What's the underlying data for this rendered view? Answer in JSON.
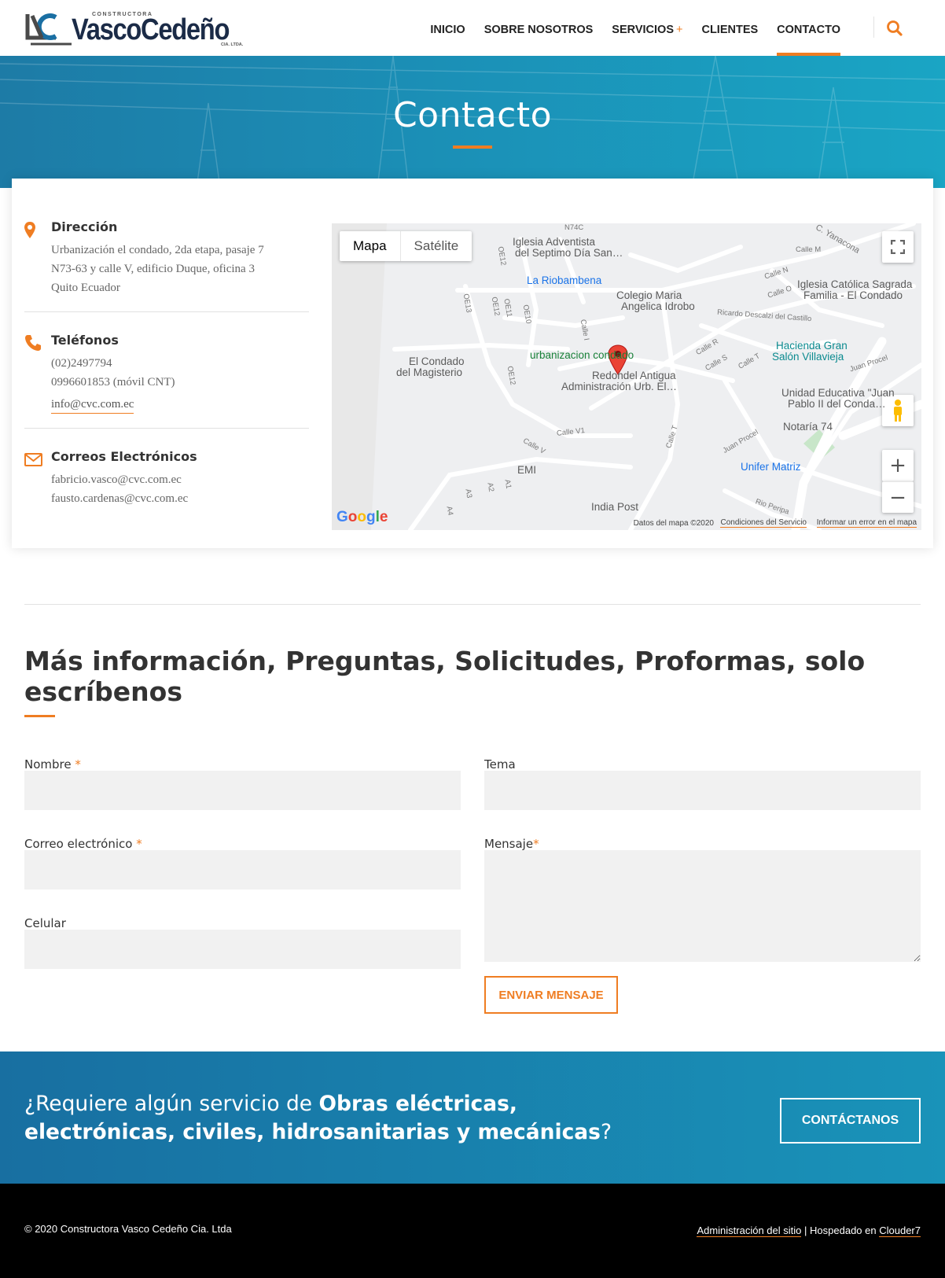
{
  "header": {
    "logo_small": "CONSTRUCTORA",
    "logo_name": "VascoCedeño",
    "logo_sub": "CIA. LTDA.",
    "nav": [
      {
        "label": "INICIO"
      },
      {
        "label": "SOBRE NOSOTROS"
      },
      {
        "label": "SERVICIOS",
        "suffix": "+"
      },
      {
        "label": "CLIENTES"
      },
      {
        "label": "CONTACTO",
        "active": true
      }
    ],
    "search_icon": "search-icon"
  },
  "hero": {
    "title": "Contacto"
  },
  "contact": {
    "address": {
      "icon": "map-pin-icon",
      "title": "Dirección",
      "lines": [
        "Urbanización el condado, 2da etapa, pasaje 7",
        "N73-63 y calle V, edificio Duque, oficina 3",
        "Quito Ecuador"
      ]
    },
    "phones": {
      "icon": "phone-icon",
      "title": "Teléfonos",
      "lines": [
        "(02)2497794",
        "0996601853 (móvil CNT)"
      ],
      "email_link": "info@cvc.com.ec"
    },
    "emails": {
      "icon": "envelope-icon",
      "title": "Correos Electrónicos",
      "lines": [
        "fabricio.vasco@cvc.com.ec",
        "fausto.cardenas@cvc.com.ec"
      ]
    }
  },
  "map": {
    "tabs": [
      "Mapa",
      "Satélite"
    ],
    "labels": {
      "iglesia_adventista": "Iglesia Adventista",
      "iglesia_adventista_2": "del Septimo Día San…",
      "la_riobambena": "La Riobambena",
      "colegio": "Colegio Maria",
      "colegio_2": "Angelica Idrobo",
      "iglesia_catolica": "Iglesia Católica Sagrada",
      "iglesia_catolica_2": "Familia - El Condado",
      "condado_magisterio": "El Condado",
      "condado_magisterio_2": "del Magisterio",
      "urbanizacion": "urbanizacion condado",
      "redondel": "Redondel Antigua",
      "redondel_2": "Administración Urb. El…",
      "hacienda": "Hacienda Gran",
      "hacienda_2": "Salón Villavieja",
      "unidad": "Unidad Educativa \"Juan",
      "unidad_2": "Pablo II del Conda…",
      "notaria": "Notaría 74",
      "unifer": "Unifer Matriz",
      "emi": "EMI",
      "india_post": "India Post",
      "ricardo": "Ricardo Descalzi del Castillo",
      "yanacona": "C. Yanacona",
      "juan_procel": "Juan Procel",
      "rio_peripa": "Rio Peripa",
      "n74c": "N74C",
      "calle_m": "Calle M",
      "calle_n": "Calle N",
      "calle_o": "Calle O",
      "calle_r": "Calle R",
      "calle_s": "Calle S",
      "calle_t": "Calle T",
      "calle_v": "Calle V",
      "calle_v1": "Calle V1",
      "calle_i": "Calle I",
      "oe13": "OE13",
      "oe12": "OE12",
      "oe11": "OE11",
      "oe10": "OE10",
      "a1": "A1",
      "a2": "A2",
      "a3": "A3",
      "a4": "A4"
    },
    "google": "Google",
    "footer_data": "Datos del mapa ©2020",
    "footer_terms": "Condiciones del Servicio",
    "footer_report": "Informar un error en el mapa",
    "fullscreen_icon": "fullscreen-icon",
    "pegman_icon": "pegman-icon",
    "zoom_in": "+",
    "zoom_out": "−"
  },
  "form": {
    "title": "Más información, Preguntas, Solicitudes, Proformas, solo escríbenos",
    "nombre_label": "Nombre",
    "correo_label": "Correo electrónico",
    "celular_label": "Celular",
    "tema_label": "Tema",
    "mensaje_label": "Mensaje",
    "required_mark": "*",
    "nombre_value": "",
    "correo_value": "",
    "celular_value": "",
    "tema_value": "",
    "mensaje_value": "",
    "submit_label": "ENVIAR MENSAJE"
  },
  "cta": {
    "prefix": "¿Requiere algún servicio de ",
    "bold": "Obras eléctricas, electrónicas, civiles, hidrosanitarias y mecánicas",
    "suffix": "?",
    "button": "CONTÁCTANOS"
  },
  "footer": {
    "copyright": "© 2020 Constructora Vasco Cedeño Cia. Ltda",
    "admin_link": "Administración del sitio",
    "separator": "|",
    "hosted_text": "Hospedado en",
    "host_link": "Clouder7"
  },
  "colors": {
    "accent": "#ef7d22",
    "hero_blue": "#1b8fb6",
    "footer": "#000000"
  }
}
